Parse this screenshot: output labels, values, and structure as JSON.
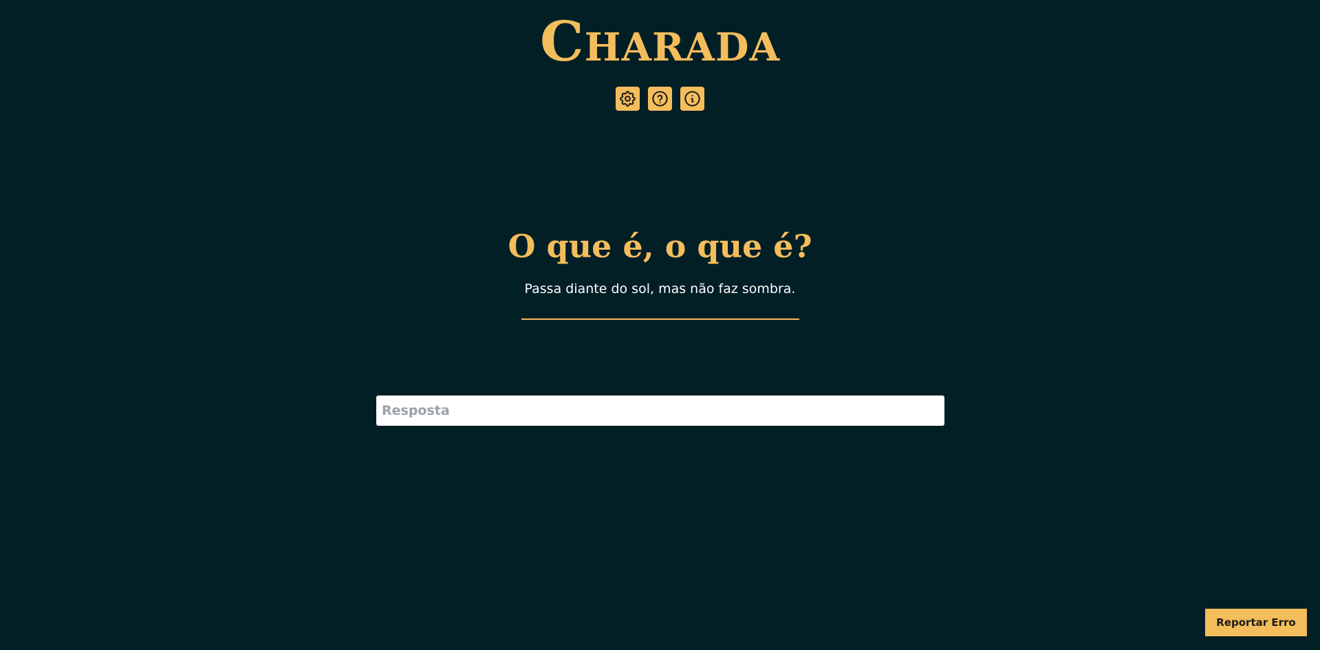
{
  "header": {
    "title": "Charada",
    "icons": [
      {
        "name": "gear-icon",
        "meaning": "settings"
      },
      {
        "name": "question-circle-icon",
        "meaning": "help"
      },
      {
        "name": "info-circle-icon",
        "meaning": "info"
      }
    ]
  },
  "riddle": {
    "heading": "O que é, o que é?",
    "text": "Passa diante do sol, mas não faz sombra."
  },
  "answer": {
    "placeholder": "Resposta",
    "value": ""
  },
  "footer": {
    "report_label": "Reportar Erro"
  },
  "colors": {
    "background": "#031f26",
    "accent": "#f4bd5c",
    "text": "#ffffff"
  }
}
